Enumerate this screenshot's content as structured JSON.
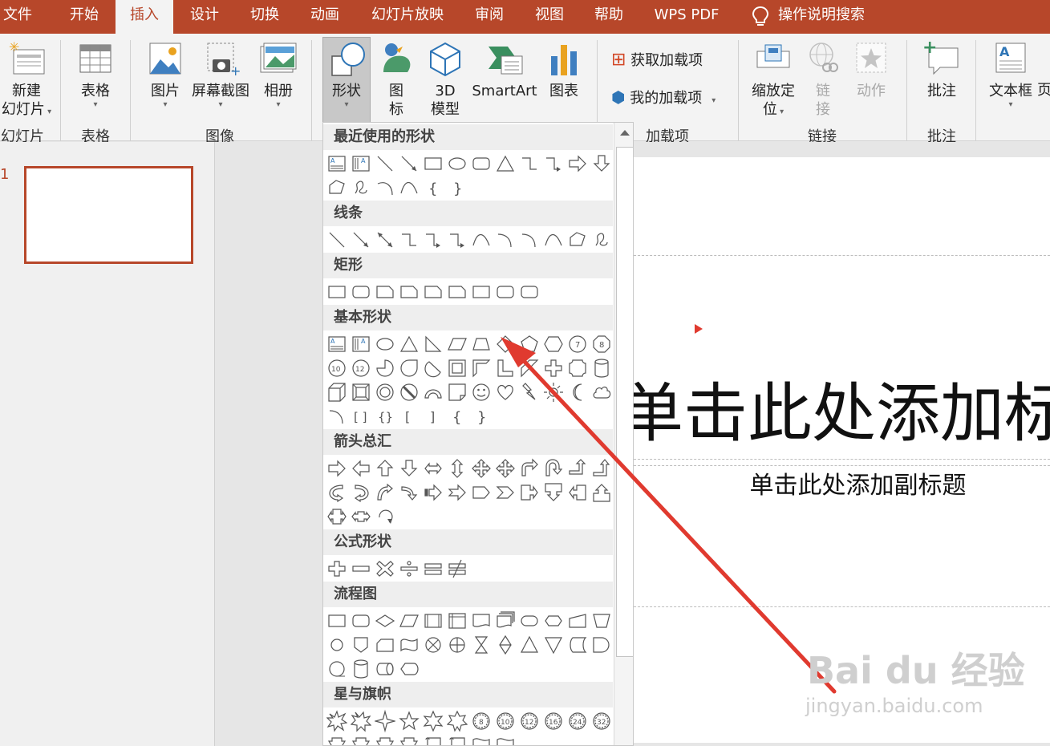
{
  "tabs": [
    {
      "label": "文件"
    },
    {
      "label": "开始"
    },
    {
      "label": "插入"
    },
    {
      "label": "设计"
    },
    {
      "label": "切换"
    },
    {
      "label": "动画"
    },
    {
      "label": "幻灯片放映"
    },
    {
      "label": "审阅"
    },
    {
      "label": "视图"
    },
    {
      "label": "帮助"
    },
    {
      "label": "WPS PDF"
    }
  ],
  "search_label": "操作说明搜索",
  "ribbon": {
    "new_slide": "新建",
    "new_slide_2": "幻灯片",
    "table": "表格",
    "picture": "图片",
    "screenshot": "屏幕截图",
    "album": "相册",
    "shapes": "形状",
    "icons_1": "图",
    "icons_2": "标",
    "model_1": "3D",
    "model_2": "模型",
    "smartart": "SmartArt",
    "chart": "图表",
    "get_addins": "获取加载项",
    "my_addins": "我的加载项",
    "zoom_1": "缩放定",
    "zoom_2": "位",
    "link_1": "链",
    "link_2": "接",
    "action": "动作",
    "comment": "批注",
    "textbox": "文本框",
    "header": "页"
  },
  "groups": {
    "slides": "幻灯片",
    "tables": "表格",
    "images": "图像",
    "addins": "加载项",
    "links": "链接",
    "comments": "批注"
  },
  "gallery": {
    "recent": "最近使用的形状",
    "lines": "线条",
    "rectangles": "矩形",
    "basic": "基本形状",
    "arrows": "箭头总汇",
    "equation": "公式形状",
    "flowchart": "流程图",
    "stars": "星与旗帜"
  },
  "slide_number": "1",
  "slide": {
    "title": "单击此处添加标",
    "subtitle": "单击此处添加副标题"
  },
  "watermark": {
    "logo": "Bai du 经验",
    "url": "jingyan.baidu.com"
  },
  "colors": {
    "accent": "#b7472a",
    "annotation_arrow": "#e03a2f"
  }
}
